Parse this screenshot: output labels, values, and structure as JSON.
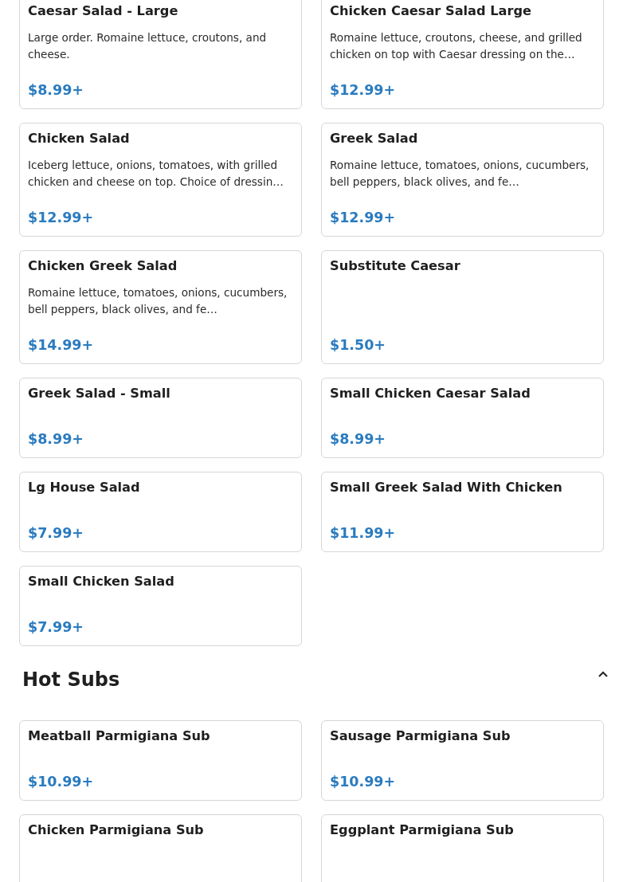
{
  "sections": [
    {
      "items": [
        {
          "name": "Caesar Salad - Large",
          "description": "Large order. Romaine lettuce, croutons, and cheese.",
          "price": "$8.99+"
        },
        {
          "name": "Chicken Caesar Salad Large",
          "description": "Romaine lettuce, croutons, cheese, and grilled chicken on top with Caesar dressing on the…",
          "price": "$12.99+"
        },
        {
          "name": "Chicken Salad",
          "description": "Iceberg lettuce, onions, tomatoes, with grilled chicken and cheese on top. Choice of dressin…",
          "price": "$12.99+"
        },
        {
          "name": "Greek Salad",
          "description": "Romaine lettuce, tomatoes, onions, cucumbers, bell peppers, black olives, and fe…",
          "price": "$12.99+"
        },
        {
          "name": "Chicken Greek Salad",
          "description": "Romaine lettuce, tomatoes, onions, cucumbers, bell peppers, black olives, and fe…",
          "price": "$14.99+"
        },
        {
          "name": "Substitute Caesar",
          "price": "$1.50+"
        },
        {
          "name": "Greek Salad - Small",
          "price": "$8.99+"
        },
        {
          "name": "Small Chicken Caesar Salad",
          "price": "$8.99+"
        },
        {
          "name": "Lg House Salad",
          "price": "$7.99+"
        },
        {
          "name": "Small Greek Salad With Chicken",
          "price": "$11.99+"
        },
        {
          "name": "Small Chicken Salad",
          "price": "$7.99+"
        }
      ]
    },
    {
      "title": "Hot Subs",
      "expanded": true,
      "items": [
        {
          "name": "Meatball Parmigiana Sub",
          "price": "$10.99+"
        },
        {
          "name": "Sausage Parmigiana Sub",
          "price": "$10.99+"
        },
        {
          "name": "Chicken Parmigiana Sub"
        },
        {
          "name": "Eggplant Parmigiana Sub"
        }
      ]
    }
  ]
}
